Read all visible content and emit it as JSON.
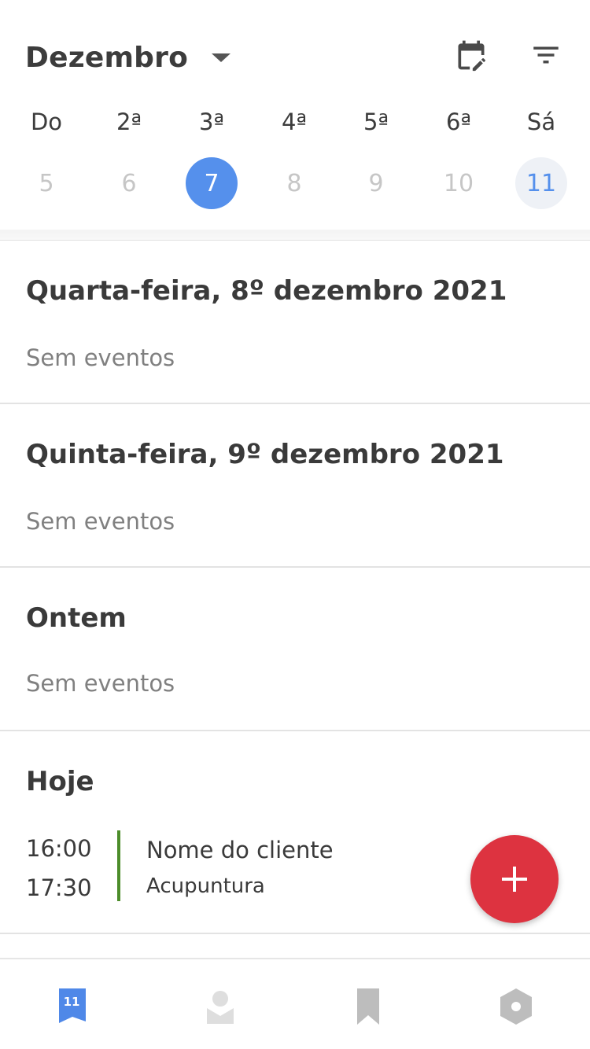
{
  "header": {
    "month": "Dezembro",
    "calendar_edit_icon": "calendar-edit-icon",
    "filter_icon": "filter-icon"
  },
  "weekdays": [
    "Do",
    "2ª",
    "3ª",
    "4ª",
    "5ª",
    "6ª",
    "Sá"
  ],
  "days": [
    {
      "label": "5",
      "state": "normal"
    },
    {
      "label": "6",
      "state": "normal"
    },
    {
      "label": "7",
      "state": "selected"
    },
    {
      "label": "8",
      "state": "normal"
    },
    {
      "label": "9",
      "state": "normal"
    },
    {
      "label": "10",
      "state": "normal"
    },
    {
      "label": "11",
      "state": "today"
    }
  ],
  "sections": [
    {
      "title": "Quarta-feira, 8º dezembro 2021",
      "empty_text": "Sem eventos"
    },
    {
      "title": "Quinta-feira, 9º dezembro 2021",
      "empty_text": "Sem eventos"
    },
    {
      "title": "Ontem",
      "empty_text": "Sem eventos"
    },
    {
      "title": "Hoje",
      "empty_text": ""
    }
  ],
  "today_event": {
    "start": "16:00",
    "end": "17:30",
    "client": "Nome do cliente",
    "service": "Acupuntura",
    "color": "#4c8d2a"
  },
  "fab": {
    "icon": "plus-icon",
    "color": "#dd3340"
  },
  "bottom_nav": [
    {
      "name": "calendar",
      "icon": "calendar-day-icon",
      "badge": "11",
      "active": true
    },
    {
      "name": "clients",
      "icon": "person-icon",
      "active": false
    },
    {
      "name": "saved",
      "icon": "bookmark-icon",
      "active": false
    },
    {
      "name": "settings",
      "icon": "settings-hex-icon",
      "active": false
    }
  ],
  "colors": {
    "accent": "#5590ec",
    "fab": "#dd3340",
    "event_bar": "#4c8d2a"
  }
}
